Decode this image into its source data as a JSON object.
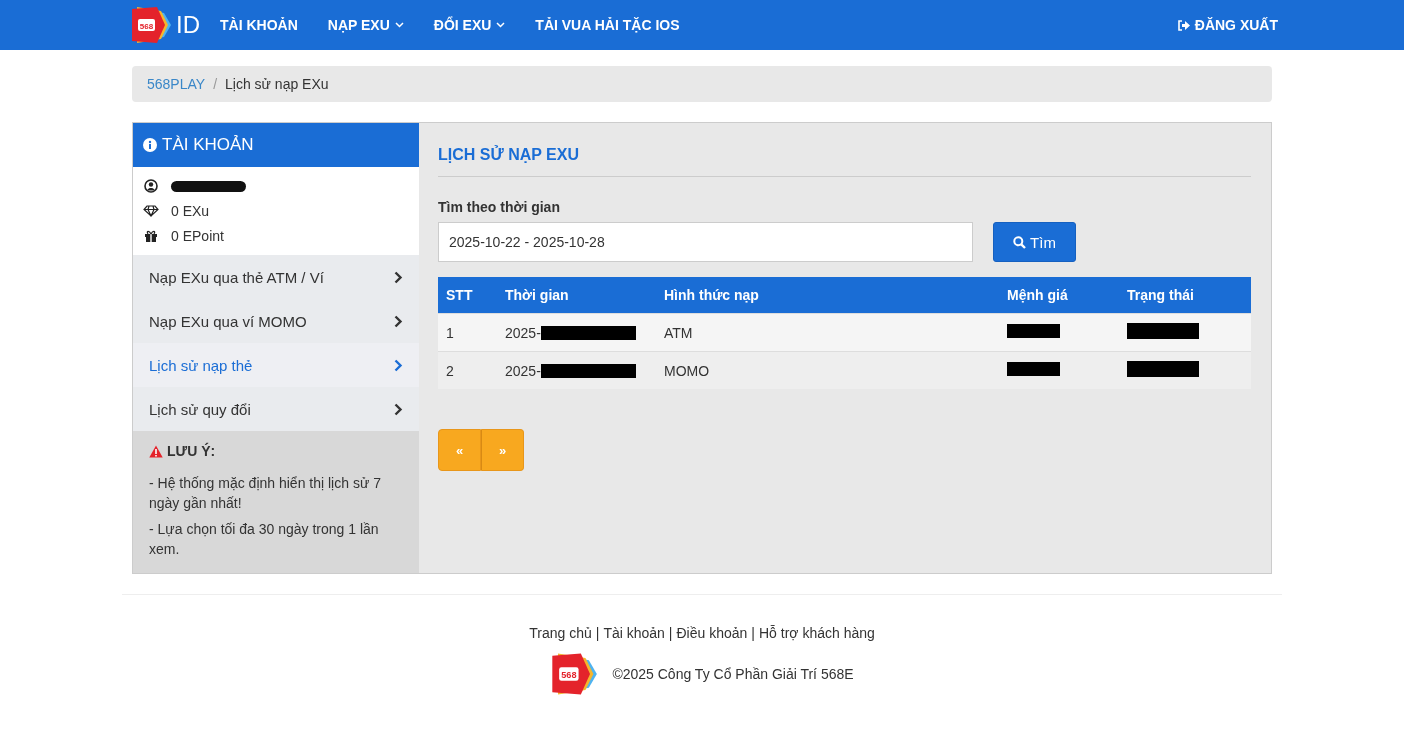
{
  "nav": {
    "logo_badge": "568",
    "logo_text": "ID",
    "items": [
      {
        "label": "TÀI KHOẢN",
        "dropdown": false
      },
      {
        "label": "NẠP EXU",
        "dropdown": true
      },
      {
        "label": "ĐỔI EXU",
        "dropdown": true
      },
      {
        "label": "TẢI VUA HẢI TẶC IOS",
        "dropdown": false
      }
    ],
    "logout": "ĐĂNG XUẤT"
  },
  "breadcrumb_separator": "/",
  "breadcrumb": [
    {
      "label": "568PLAY",
      "link": true
    },
    {
      "label": "Lịch sử nạp EXu",
      "link": false
    }
  ],
  "sidebar": {
    "title": "TÀI KHOẢN",
    "username_redacted": true,
    "balances": [
      {
        "kind": "diamond",
        "text": "0 EXu"
      },
      {
        "kind": "gift",
        "text": "0 EPoint"
      }
    ],
    "items": [
      {
        "label": "Nạp EXu qua thẻ ATM / Ví",
        "selected": false
      },
      {
        "label": "Nạp EXu qua ví MOMO",
        "selected": false
      },
      {
        "label": "Lịch sử nạp thẻ",
        "selected": true
      },
      {
        "label": "Lịch sử quy đổi",
        "selected": false
      }
    ],
    "note": {
      "title": "LƯU Ý:",
      "lines": [
        "- Hệ thống mặc định hiển thị lịch sử 7 ngày gần nhất!",
        "- Lựa chọn tối đa 30 ngày trong 1 lần xem."
      ]
    }
  },
  "main": {
    "title": "LỊCH SỬ NẠP EXU",
    "search_label": "Tìm theo thời gian",
    "date_range": "2025-10-22 - 2025-10-28",
    "search_button": "Tìm",
    "table": {
      "columns": [
        "STT",
        "Thời gian",
        "Hình thức nạp",
        "Mệnh giá",
        "Trạng thái"
      ],
      "rows": [
        [
          {
            "text": "1"
          },
          {
            "text": "2025-",
            "redacted": true
          },
          {
            "text": "ATM"
          },
          {
            "redacted": true
          },
          {
            "redacted": true
          }
        ],
        [
          {
            "text": "2"
          },
          {
            "text": "2025-",
            "redacted": true
          },
          {
            "text": "MOMO"
          },
          {
            "redacted": true
          },
          {
            "redacted": true
          }
        ]
      ]
    },
    "pagination": [
      "«",
      "»"
    ]
  },
  "footer": {
    "separator": "|",
    "links": [
      "Trang chủ",
      "Tài khoản",
      "Điều khoản",
      "Hỗ trợ khách hàng"
    ],
    "copyright": "©2025 Công Ty Cổ Phần Giải Trí 568E",
    "logo_badge": "568"
  }
}
